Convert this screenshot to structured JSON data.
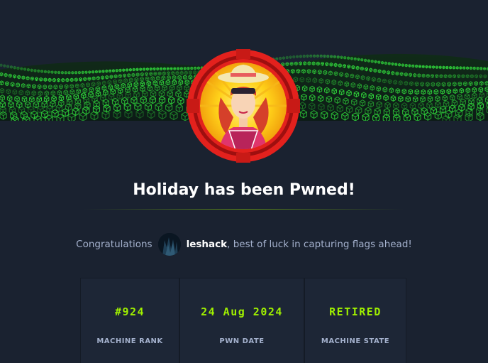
{
  "title": "Holiday has been Pwned!",
  "congrats": {
    "prefix": "Congratulations",
    "username": "leshack",
    "suffix": ", best of luck in capturing flags ahead!"
  },
  "stats": [
    {
      "value": "#924",
      "label": "MACHINE RANK"
    },
    {
      "value": "24 Aug 2024",
      "label": "PWN DATE"
    },
    {
      "value": "RETIRED",
      "label": "MACHINE STATE"
    }
  ],
  "colors": {
    "background": "#1a2230",
    "accent": "#9fef00",
    "badge_ring": "#e3211d",
    "muted_text": "#a4b1cd"
  }
}
